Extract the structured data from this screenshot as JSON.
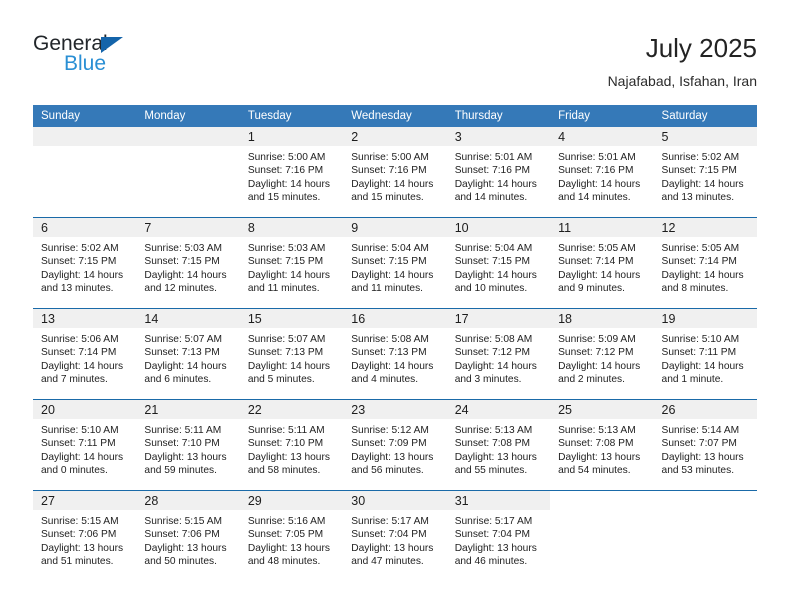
{
  "brand": {
    "name_top": "General",
    "name_bottom": "Blue",
    "triangle_color": "#1464aa",
    "blue_text_color": "#2a8fd4"
  },
  "header": {
    "title": "July 2025",
    "subtitle": "Najafabad, Isfahan, Iran"
  },
  "theme": {
    "header_bg": "#3579b8",
    "row_divider": "#1a6aa8",
    "daynum_band": "#f0f0f0",
    "page_bg": "#ffffff"
  },
  "calendar": {
    "weekday_headers": [
      "Sunday",
      "Monday",
      "Tuesday",
      "Wednesday",
      "Thursday",
      "Friday",
      "Saturday"
    ],
    "weeks": [
      [
        {
          "day": "",
          "sunrise": "",
          "sunset": "",
          "daylight_1": "",
          "daylight_2": "",
          "state": "empty"
        },
        {
          "day": "",
          "sunrise": "",
          "sunset": "",
          "daylight_1": "",
          "daylight_2": "",
          "state": "empty"
        },
        {
          "day": "1",
          "sunrise": "Sunrise: 5:00 AM",
          "sunset": "Sunset: 7:16 PM",
          "daylight_1": "Daylight: 14 hours",
          "daylight_2": "and 15 minutes.",
          "state": "filled"
        },
        {
          "day": "2",
          "sunrise": "Sunrise: 5:00 AM",
          "sunset": "Sunset: 7:16 PM",
          "daylight_1": "Daylight: 14 hours",
          "daylight_2": "and 15 minutes.",
          "state": "filled"
        },
        {
          "day": "3",
          "sunrise": "Sunrise: 5:01 AM",
          "sunset": "Sunset: 7:16 PM",
          "daylight_1": "Daylight: 14 hours",
          "daylight_2": "and 14 minutes.",
          "state": "filled"
        },
        {
          "day": "4",
          "sunrise": "Sunrise: 5:01 AM",
          "sunset": "Sunset: 7:16 PM",
          "daylight_1": "Daylight: 14 hours",
          "daylight_2": "and 14 minutes.",
          "state": "filled"
        },
        {
          "day": "5",
          "sunrise": "Sunrise: 5:02 AM",
          "sunset": "Sunset: 7:15 PM",
          "daylight_1": "Daylight: 14 hours",
          "daylight_2": "and 13 minutes.",
          "state": "filled"
        }
      ],
      [
        {
          "day": "6",
          "sunrise": "Sunrise: 5:02 AM",
          "sunset": "Sunset: 7:15 PM",
          "daylight_1": "Daylight: 14 hours",
          "daylight_2": "and 13 minutes.",
          "state": "filled"
        },
        {
          "day": "7",
          "sunrise": "Sunrise: 5:03 AM",
          "sunset": "Sunset: 7:15 PM",
          "daylight_1": "Daylight: 14 hours",
          "daylight_2": "and 12 minutes.",
          "state": "filled"
        },
        {
          "day": "8",
          "sunrise": "Sunrise: 5:03 AM",
          "sunset": "Sunset: 7:15 PM",
          "daylight_1": "Daylight: 14 hours",
          "daylight_2": "and 11 minutes.",
          "state": "filled"
        },
        {
          "day": "9",
          "sunrise": "Sunrise: 5:04 AM",
          "sunset": "Sunset: 7:15 PM",
          "daylight_1": "Daylight: 14 hours",
          "daylight_2": "and 11 minutes.",
          "state": "filled"
        },
        {
          "day": "10",
          "sunrise": "Sunrise: 5:04 AM",
          "sunset": "Sunset: 7:15 PM",
          "daylight_1": "Daylight: 14 hours",
          "daylight_2": "and 10 minutes.",
          "state": "filled"
        },
        {
          "day": "11",
          "sunrise": "Sunrise: 5:05 AM",
          "sunset": "Sunset: 7:14 PM",
          "daylight_1": "Daylight: 14 hours",
          "daylight_2": "and 9 minutes.",
          "state": "filled"
        },
        {
          "day": "12",
          "sunrise": "Sunrise: 5:05 AM",
          "sunset": "Sunset: 7:14 PM",
          "daylight_1": "Daylight: 14 hours",
          "daylight_2": "and 8 minutes.",
          "state": "filled"
        }
      ],
      [
        {
          "day": "13",
          "sunrise": "Sunrise: 5:06 AM",
          "sunset": "Sunset: 7:14 PM",
          "daylight_1": "Daylight: 14 hours",
          "daylight_2": "and 7 minutes.",
          "state": "filled"
        },
        {
          "day": "14",
          "sunrise": "Sunrise: 5:07 AM",
          "sunset": "Sunset: 7:13 PM",
          "daylight_1": "Daylight: 14 hours",
          "daylight_2": "and 6 minutes.",
          "state": "filled"
        },
        {
          "day": "15",
          "sunrise": "Sunrise: 5:07 AM",
          "sunset": "Sunset: 7:13 PM",
          "daylight_1": "Daylight: 14 hours",
          "daylight_2": "and 5 minutes.",
          "state": "filled"
        },
        {
          "day": "16",
          "sunrise": "Sunrise: 5:08 AM",
          "sunset": "Sunset: 7:13 PM",
          "daylight_1": "Daylight: 14 hours",
          "daylight_2": "and 4 minutes.",
          "state": "filled"
        },
        {
          "day": "17",
          "sunrise": "Sunrise: 5:08 AM",
          "sunset": "Sunset: 7:12 PM",
          "daylight_1": "Daylight: 14 hours",
          "daylight_2": "and 3 minutes.",
          "state": "filled"
        },
        {
          "day": "18",
          "sunrise": "Sunrise: 5:09 AM",
          "sunset": "Sunset: 7:12 PM",
          "daylight_1": "Daylight: 14 hours",
          "daylight_2": "and 2 minutes.",
          "state": "filled"
        },
        {
          "day": "19",
          "sunrise": "Sunrise: 5:10 AM",
          "sunset": "Sunset: 7:11 PM",
          "daylight_1": "Daylight: 14 hours",
          "daylight_2": "and 1 minute.",
          "state": "filled"
        }
      ],
      [
        {
          "day": "20",
          "sunrise": "Sunrise: 5:10 AM",
          "sunset": "Sunset: 7:11 PM",
          "daylight_1": "Daylight: 14 hours",
          "daylight_2": "and 0 minutes.",
          "state": "filled"
        },
        {
          "day": "21",
          "sunrise": "Sunrise: 5:11 AM",
          "sunset": "Sunset: 7:10 PM",
          "daylight_1": "Daylight: 13 hours",
          "daylight_2": "and 59 minutes.",
          "state": "filled"
        },
        {
          "day": "22",
          "sunrise": "Sunrise: 5:11 AM",
          "sunset": "Sunset: 7:10 PM",
          "daylight_1": "Daylight: 13 hours",
          "daylight_2": "and 58 minutes.",
          "state": "filled"
        },
        {
          "day": "23",
          "sunrise": "Sunrise: 5:12 AM",
          "sunset": "Sunset: 7:09 PM",
          "daylight_1": "Daylight: 13 hours",
          "daylight_2": "and 56 minutes.",
          "state": "filled"
        },
        {
          "day": "24",
          "sunrise": "Sunrise: 5:13 AM",
          "sunset": "Sunset: 7:08 PM",
          "daylight_1": "Daylight: 13 hours",
          "daylight_2": "and 55 minutes.",
          "state": "filled"
        },
        {
          "day": "25",
          "sunrise": "Sunrise: 5:13 AM",
          "sunset": "Sunset: 7:08 PM",
          "daylight_1": "Daylight: 13 hours",
          "daylight_2": "and 54 minutes.",
          "state": "filled"
        },
        {
          "day": "26",
          "sunrise": "Sunrise: 5:14 AM",
          "sunset": "Sunset: 7:07 PM",
          "daylight_1": "Daylight: 13 hours",
          "daylight_2": "and 53 minutes.",
          "state": "filled"
        }
      ],
      [
        {
          "day": "27",
          "sunrise": "Sunrise: 5:15 AM",
          "sunset": "Sunset: 7:06 PM",
          "daylight_1": "Daylight: 13 hours",
          "daylight_2": "and 51 minutes.",
          "state": "filled"
        },
        {
          "day": "28",
          "sunrise": "Sunrise: 5:15 AM",
          "sunset": "Sunset: 7:06 PM",
          "daylight_1": "Daylight: 13 hours",
          "daylight_2": "and 50 minutes.",
          "state": "filled"
        },
        {
          "day": "29",
          "sunrise": "Sunrise: 5:16 AM",
          "sunset": "Sunset: 7:05 PM",
          "daylight_1": "Daylight: 13 hours",
          "daylight_2": "and 48 minutes.",
          "state": "filled"
        },
        {
          "day": "30",
          "sunrise": "Sunrise: 5:17 AM",
          "sunset": "Sunset: 7:04 PM",
          "daylight_1": "Daylight: 13 hours",
          "daylight_2": "and 47 minutes.",
          "state": "filled"
        },
        {
          "day": "31",
          "sunrise": "Sunrise: 5:17 AM",
          "sunset": "Sunset: 7:04 PM",
          "daylight_1": "Daylight: 13 hours",
          "daylight_2": "and 46 minutes.",
          "state": "filled"
        },
        {
          "day": "",
          "sunrise": "",
          "sunset": "",
          "daylight_1": "",
          "daylight_2": "",
          "state": "blank"
        },
        {
          "day": "",
          "sunrise": "",
          "sunset": "",
          "daylight_1": "",
          "daylight_2": "",
          "state": "blank"
        }
      ]
    ]
  }
}
